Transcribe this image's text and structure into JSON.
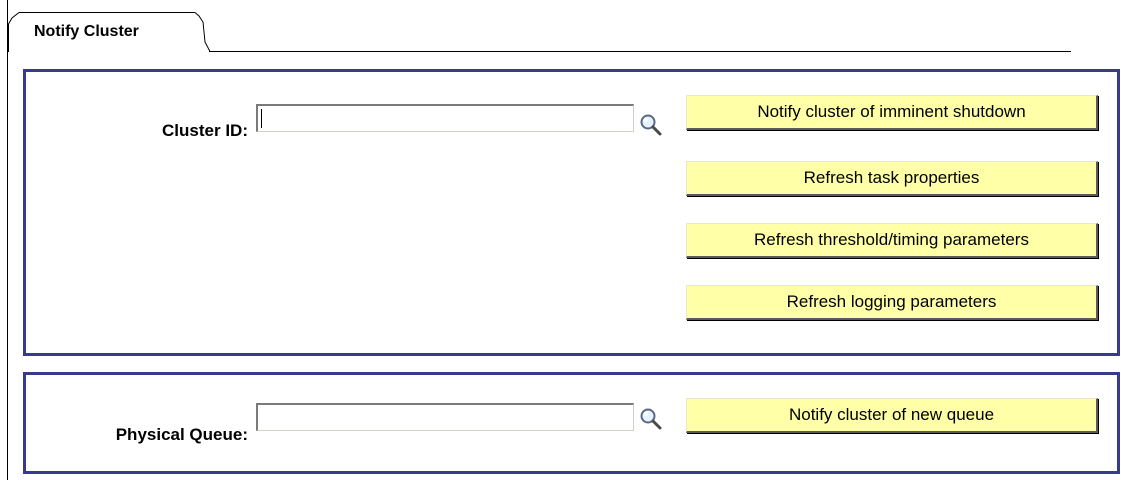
{
  "tab": {
    "label": "Notify Cluster"
  },
  "cluster_section": {
    "label": "Cluster ID:",
    "input_value": "",
    "lookup_icon": "magnifier-icon",
    "buttons": {
      "notify_shutdown": "Notify cluster of imminent shutdown",
      "refresh_task": "Refresh task properties",
      "refresh_threshold": "Refresh threshold/timing parameters",
      "refresh_logging": "Refresh logging parameters"
    }
  },
  "queue_section": {
    "label": "Physical Queue:",
    "input_value": "",
    "lookup_icon": "magnifier-icon",
    "buttons": {
      "notify_queue": "Notify cluster of new queue"
    }
  },
  "colors": {
    "group_border": "#383b8c",
    "button_background": "#ffffa8"
  }
}
